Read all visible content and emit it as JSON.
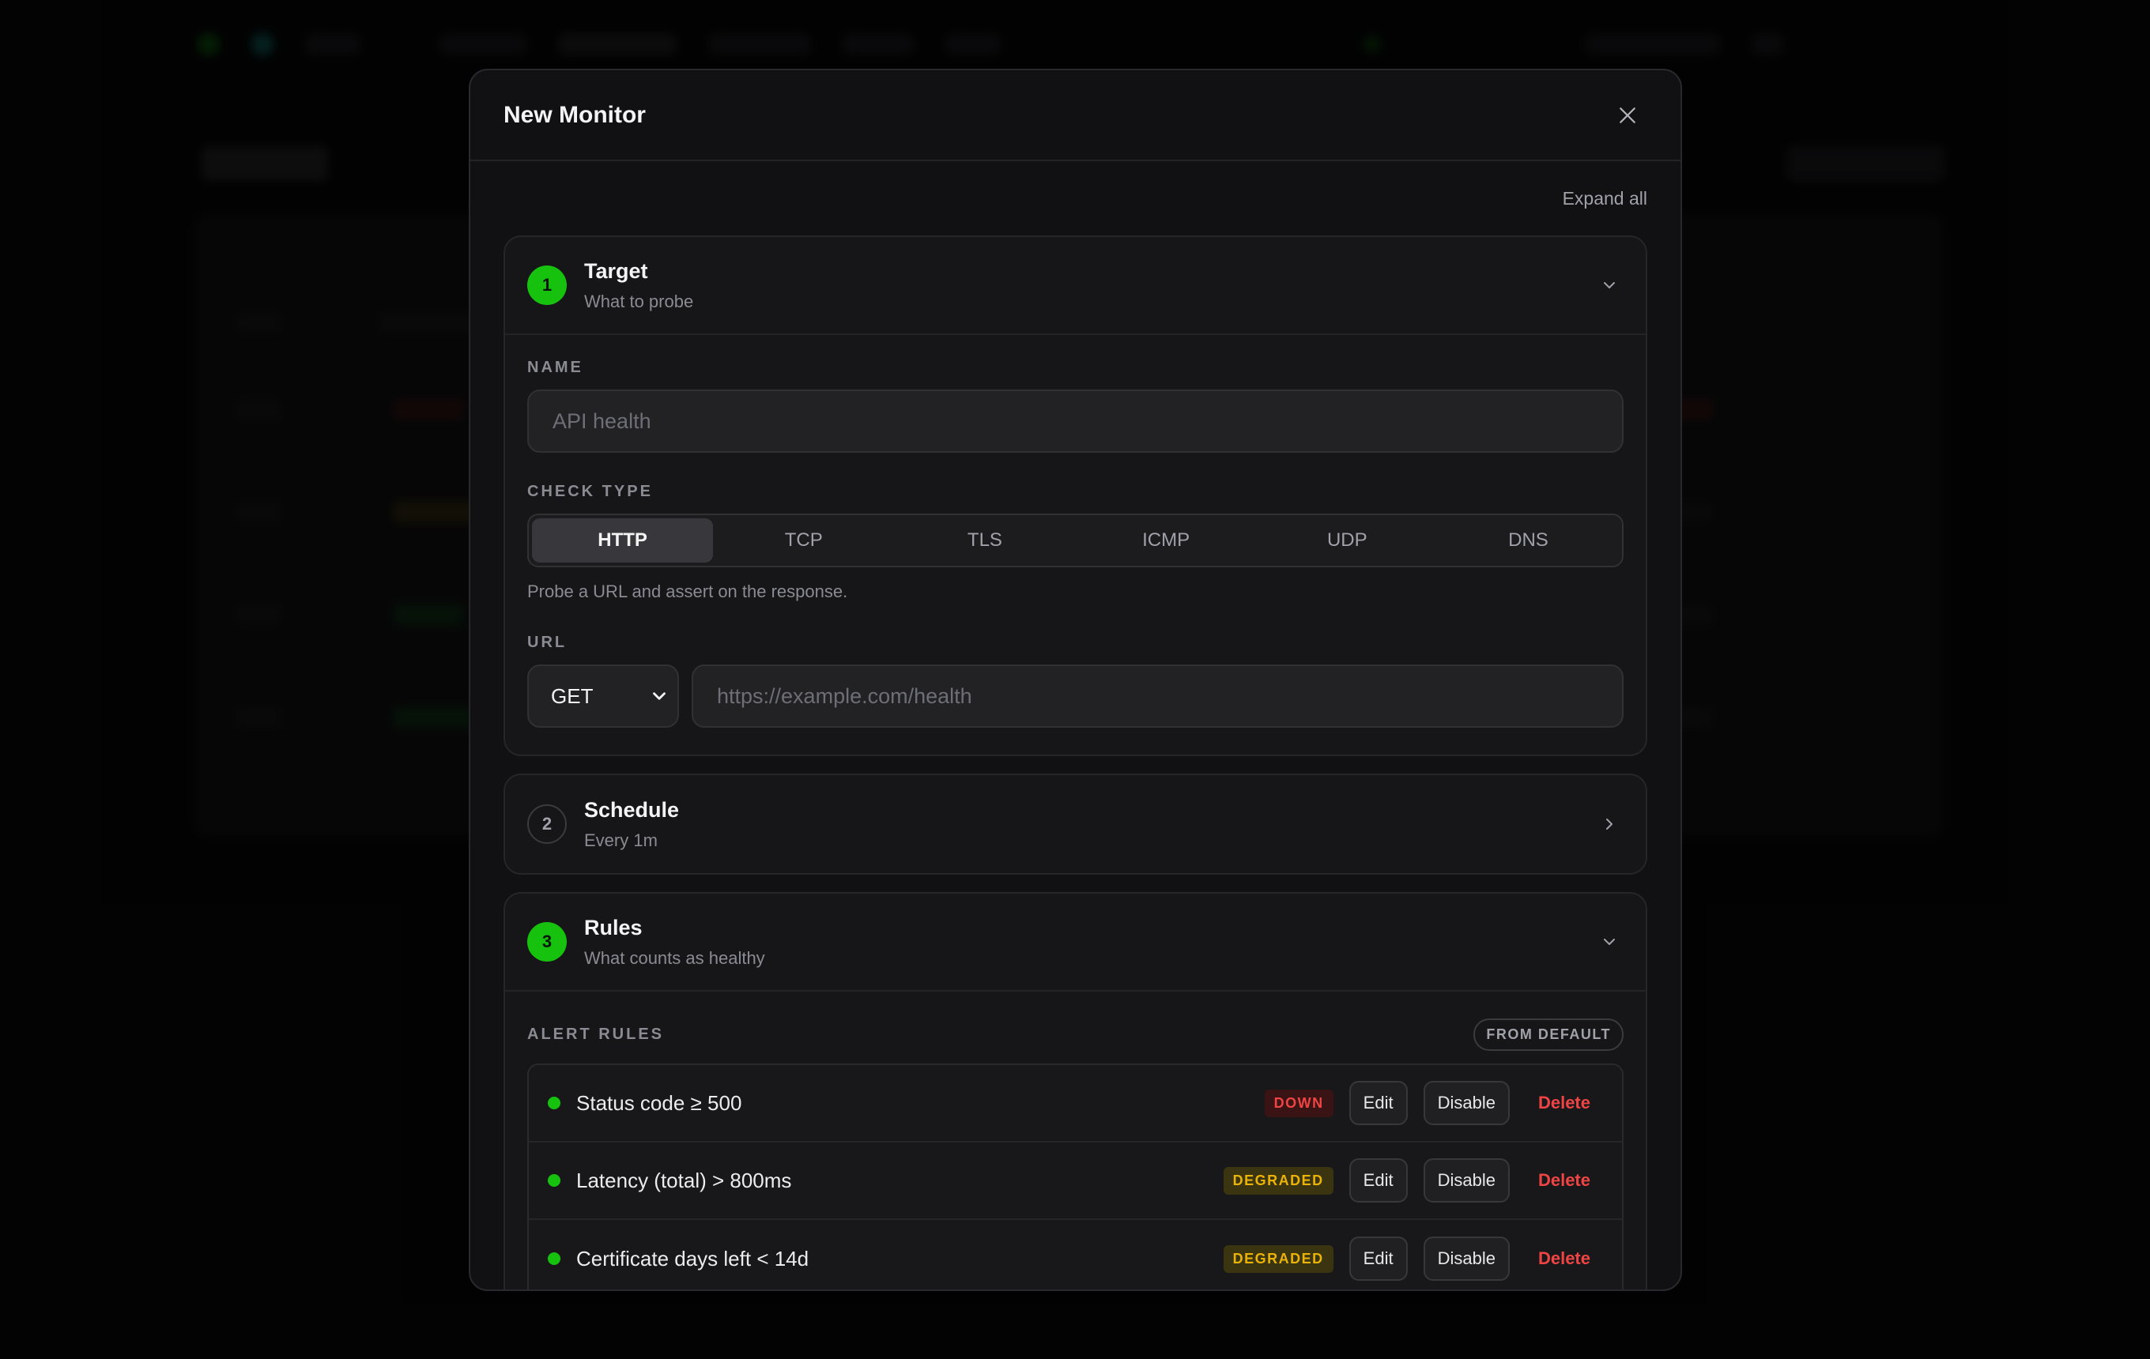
{
  "modal": {
    "title": "New Monitor",
    "expand_all": "Expand all",
    "close_icon": "close-icon"
  },
  "sections": {
    "target": {
      "step": "1",
      "title": "Target",
      "subtitle": "What to probe",
      "expanded": true,
      "name_label": "NAME",
      "name_placeholder": "API health",
      "check_type_label": "CHECK TYPE",
      "check_types": [
        "HTTP",
        "TCP",
        "TLS",
        "ICMP",
        "UDP",
        "DNS"
      ],
      "check_type_selected": "HTTP",
      "check_type_hint": "Probe a URL and assert on the response.",
      "url_label": "URL",
      "method": "GET",
      "url_placeholder": "https://example.com/health"
    },
    "schedule": {
      "step": "2",
      "title": "Schedule",
      "subtitle": "Every 1m",
      "expanded": false
    },
    "rules": {
      "step": "3",
      "title": "Rules",
      "subtitle": "What counts as healthy",
      "expanded": true,
      "alert_rules_label": "ALERT RULES",
      "source_badge": "FROM DEFAULT",
      "items": [
        {
          "text": "Status code ≥ 500",
          "severity": "DOWN",
          "edit": "Edit",
          "disable": "Disable",
          "delete": "Delete"
        },
        {
          "text": "Latency (total) > 800ms",
          "severity": "DEGRADED",
          "edit": "Edit",
          "disable": "Disable",
          "delete": "Delete"
        },
        {
          "text": "Certificate days left < 14d",
          "severity": "DEGRADED",
          "edit": "Edit",
          "disable": "Disable",
          "delete": "Delete"
        }
      ]
    }
  },
  "colors": {
    "accent_green": "#16c20e",
    "danger_red": "#ef4444",
    "warning_yellow": "#eab308",
    "modal_bg": "#111113"
  }
}
